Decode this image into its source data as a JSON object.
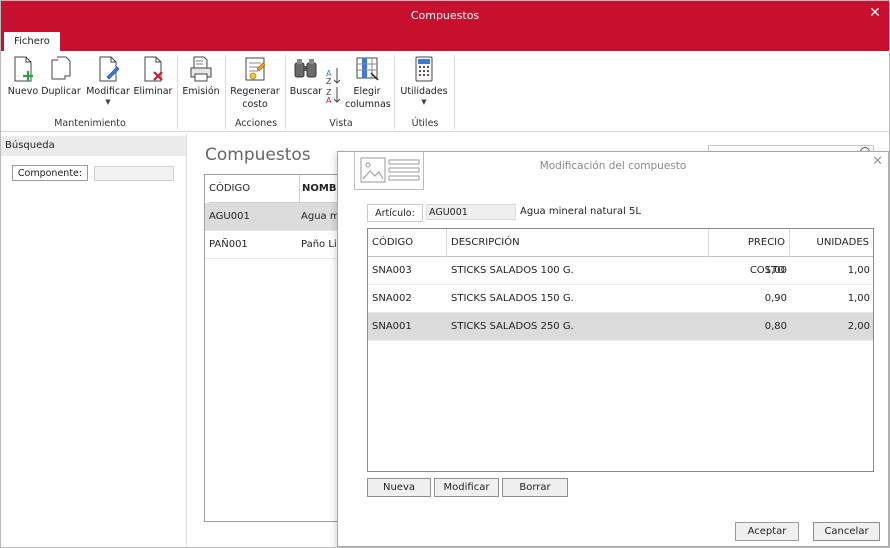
{
  "window": {
    "title": "Compuestos"
  },
  "tabs": [
    {
      "label": "Fichero"
    }
  ],
  "ribbon": {
    "mantenimiento": {
      "label": "Mantenimiento",
      "buttons": {
        "nuevo": "Nuevo",
        "duplicar": "Duplicar",
        "modificar": "Modificar",
        "eliminar": "Eliminar"
      }
    },
    "emision": {
      "label": "Emisión"
    },
    "acciones": {
      "label": "Acciones",
      "regenerar_line1": "Regenerar",
      "regenerar_line2": "costo"
    },
    "vista": {
      "label": "Vista",
      "buscar": "Buscar",
      "elegir_line1": "Elegir",
      "elegir_line2": "columnas"
    },
    "utiles": {
      "label": "Útiles",
      "utilidades": "Utilidades"
    }
  },
  "search_panel": {
    "title": "Búsqueda",
    "componente_label": "Componente:",
    "componente_value": ""
  },
  "main": {
    "title": "Compuestos",
    "search_placeholder": "",
    "columns": [
      "CÓDIGO",
      "NOMBRE"
    ],
    "rows": [
      {
        "codigo": "AGU001",
        "nombre": "Agua m",
        "selected": true
      },
      {
        "codigo": "PAÑ001",
        "nombre": "Paño Li",
        "selected": false
      }
    ]
  },
  "dialog": {
    "title": "Modificación del compuesto",
    "articulo_label": "Artículo:",
    "articulo_code": "AGU001",
    "articulo_desc": "Agua mineral natural 5L",
    "columns": {
      "codigo": "CÓDIGO",
      "descripcion": "DESCRIPCIÓN",
      "precio": "PRECIO COSTO",
      "unidades": "UNIDADES"
    },
    "rows": [
      {
        "codigo": "SNA003",
        "descripcion": "STICKS SALADOS 100 G.",
        "precio": "1,00",
        "unidades": "1,00"
      },
      {
        "codigo": "SNA002",
        "descripcion": "STICKS SALADOS 150 G.",
        "precio": "0,90",
        "unidades": "1,00"
      },
      {
        "codigo": "SNA001",
        "descripcion": "STICKS SALADOS 250 G.",
        "precio": "0,80",
        "unidades": "2,00"
      }
    ],
    "buttons": {
      "nueva": "Nueva",
      "modificar": "Modificar",
      "borrar": "Borrar",
      "aceptar": "Aceptar",
      "cancelar": "Cancelar"
    }
  },
  "colors": {
    "accent": "#c8102e",
    "selection": "#dcdcdc"
  }
}
